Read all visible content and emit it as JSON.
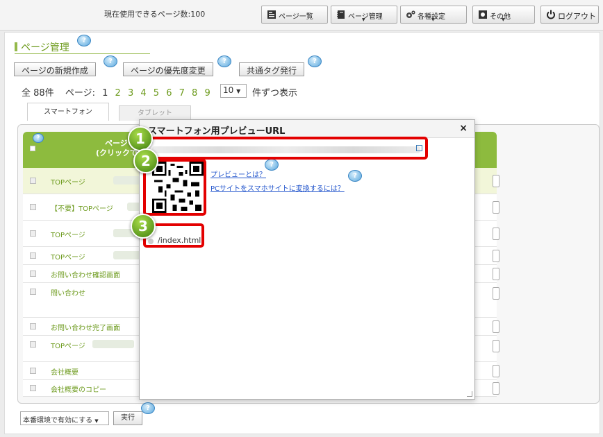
{
  "header": {
    "page_count_text": "現在使用できるページ数:100",
    "nav": [
      {
        "label": "ページ一覧",
        "icon": "page-list-icon"
      },
      {
        "label": "ページ管理",
        "icon": "notebook-icon"
      },
      {
        "label": "各種設定",
        "icon": "gears-icon"
      },
      {
        "label": "その他",
        "icon": "other-icon"
      },
      {
        "label": "ログアウト",
        "icon": "power-icon"
      }
    ]
  },
  "section": {
    "title": "ページ管理",
    "buttons": {
      "new_page": "ページの新規作成",
      "priority": "ページの優先度変更",
      "common_tag": "共通タグ発行"
    }
  },
  "pager": {
    "total": "全 88件",
    "page_label": "ページ:",
    "current": "1",
    "pages": [
      "2",
      "3",
      "4",
      "5",
      "6",
      "7",
      "8",
      "9"
    ],
    "per_page": "10",
    "per_page_text": "件ずつ表示"
  },
  "tabs": [
    "スマートフォン",
    "タブレット"
  ],
  "table": {
    "header_line1": "ページ",
    "header_line2": "(クリックで",
    "rows": [
      "TOPページ",
      "【不要】TOPページ",
      "TOPページ",
      "TOPページ",
      "お問い合わせ確認画面",
      "問い合わせ",
      "お問い合わせ完了画面",
      "TOPページ",
      "会社概要",
      "会社概要のコピー"
    ]
  },
  "bottom": {
    "select_value": "本番環境で有効にする",
    "exec_label": "実行"
  },
  "dialog": {
    "title": "スマートフォン用プレビューURL",
    "close": "×",
    "link_preview": "プレビューとは？",
    "link_convert": "PCサイトをスマホサイトに変換するには？",
    "path": "/index.html"
  },
  "markers": [
    "1",
    "2",
    "3"
  ],
  "colors": {
    "accent_green": "#8dbb3e",
    "annotation_red": "#e30000",
    "link_blue": "#2255cc"
  }
}
